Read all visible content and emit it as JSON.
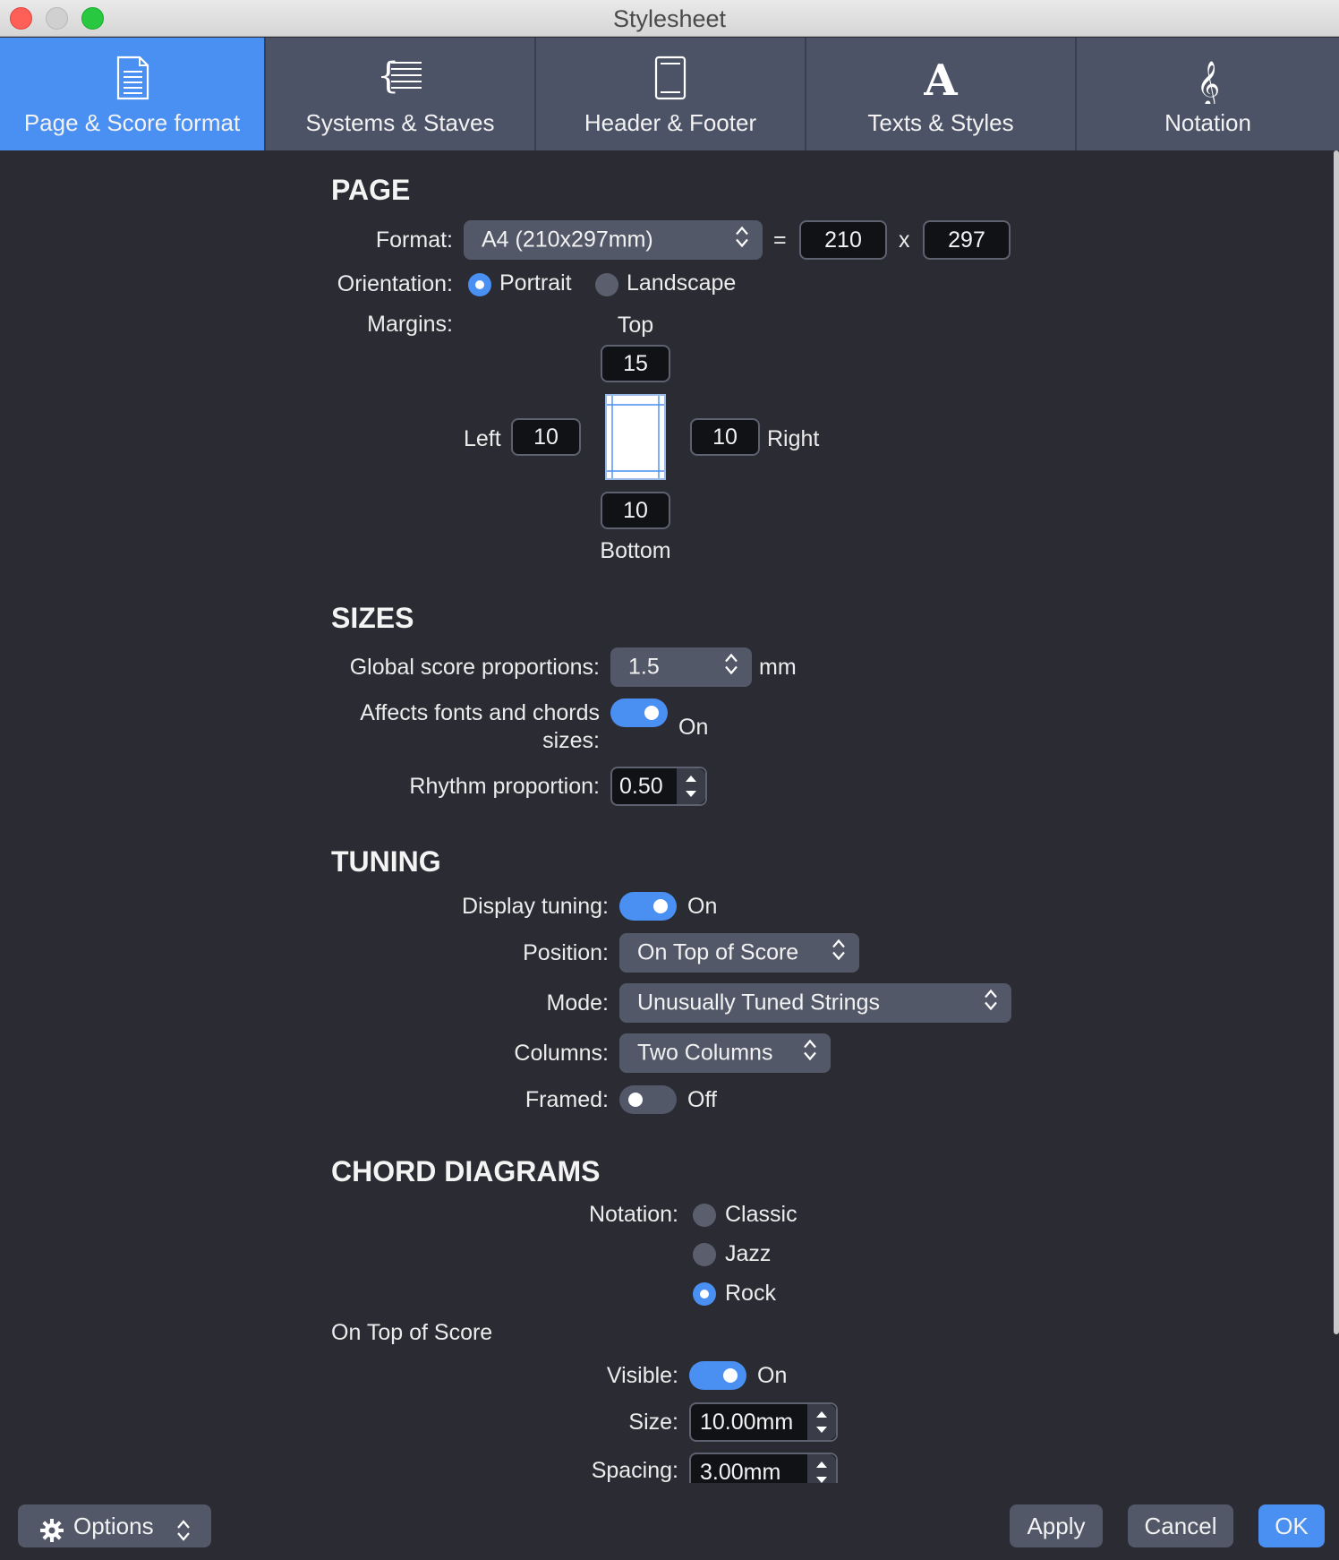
{
  "window": {
    "title": "Stylesheet"
  },
  "tabs": [
    {
      "label": "Page & Score format",
      "icon": "page-icon",
      "active": true
    },
    {
      "label": "Systems & Staves",
      "icon": "systems-staves-icon",
      "active": false
    },
    {
      "label": "Header & Footer",
      "icon": "header-footer-icon",
      "active": false
    },
    {
      "label": "Texts & Styles",
      "icon": "text-styles-icon",
      "active": false
    },
    {
      "label": "Notation",
      "icon": "treble-clef-icon",
      "active": false
    }
  ],
  "page": {
    "heading": "PAGE",
    "format_label": "Format:",
    "format_value": "A4 (210x297mm)",
    "equals": "=",
    "width": "210",
    "times": "x",
    "height": "297",
    "orientation_label": "Orientation:",
    "orientation_options": [
      "Portrait",
      "Landscape"
    ],
    "orientation_selected": "Portrait",
    "margins_label": "Margins:",
    "margin_top_label": "Top",
    "margin_top": "15",
    "margin_left_label": "Left",
    "margin_left": "10",
    "margin_right": "10",
    "margin_right_label": "Right",
    "margin_bottom": "10",
    "margin_bottom_label": "Bottom"
  },
  "sizes": {
    "heading": "SIZES",
    "global_label": "Global score proportions:",
    "global_value": "1.5",
    "global_unit": "mm",
    "affects_label_1": "Affects fonts and chords",
    "affects_label_2": "sizes:",
    "affects_state": "On",
    "rhythm_label": "Rhythm proportion:",
    "rhythm_value": "0.50"
  },
  "tuning": {
    "heading": "TUNING",
    "display_label": "Display tuning:",
    "display_state": "On",
    "position_label": "Position:",
    "position_value": "On Top of Score",
    "mode_label": "Mode:",
    "mode_value": "Unusually Tuned Strings",
    "columns_label": "Columns:",
    "columns_value": "Two Columns",
    "framed_label": "Framed:",
    "framed_state": "Off"
  },
  "chord_diagrams": {
    "heading": "CHORD DIAGRAMS",
    "notation_label": "Notation:",
    "notation_options": [
      "Classic",
      "Jazz",
      "Rock"
    ],
    "notation_selected": "Rock",
    "subheading": "On Top of Score",
    "visible_label": "Visible:",
    "visible_state": "On",
    "size_label": "Size:",
    "size_value": "10.00mm",
    "spacing_label": "Spacing:",
    "spacing_value": "3.00mm"
  },
  "footer": {
    "options_label": "Options",
    "apply_label": "Apply",
    "cancel_label": "Cancel",
    "ok_label": "OK"
  },
  "colors": {
    "accent": "#4a8ff2",
    "background": "#2b2c33",
    "tabbar": "#4c5366",
    "control": "#535869"
  }
}
